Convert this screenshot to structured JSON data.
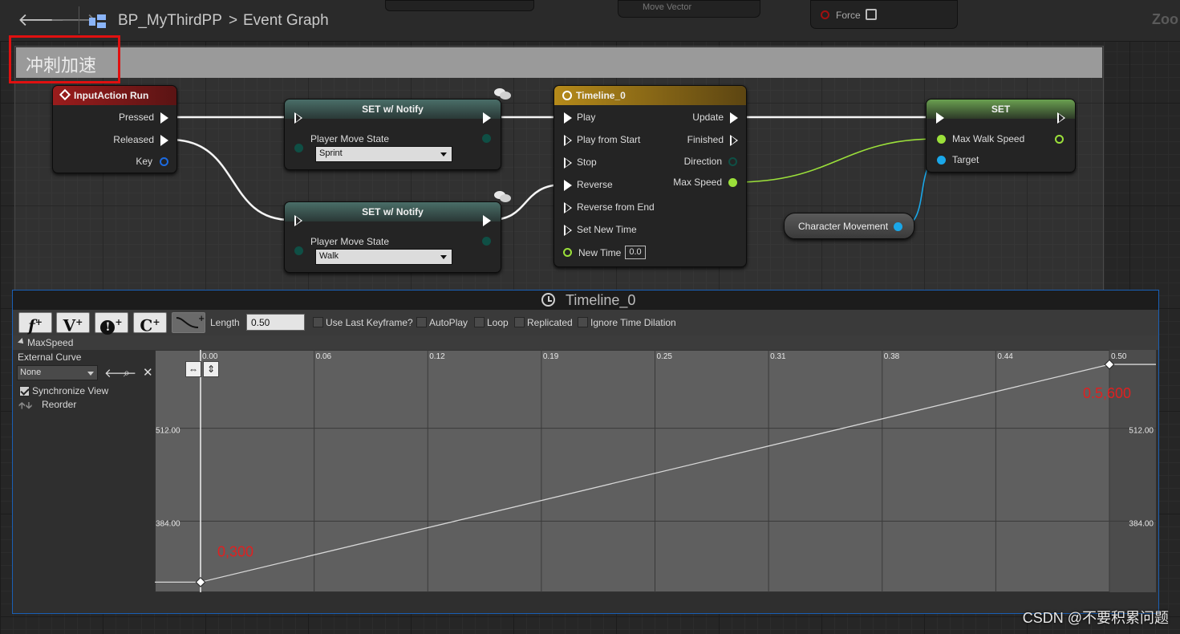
{
  "breadcrumb": {
    "blueprint": "BP_MyThirdPP",
    "separator": ">",
    "graph": "Event Graph"
  },
  "top_partial": {
    "zoom": "Zoo",
    "force": "Force",
    "move_vector": "Move Vector"
  },
  "comment": {
    "title": "冲刺加速"
  },
  "nodes": {
    "input_action": {
      "title": "InputAction Run",
      "pressed": "Pressed",
      "released": "Released",
      "key": "Key"
    },
    "set_sprint": {
      "title": "SET w/ Notify",
      "prop": "Player Move State",
      "value": "Sprint"
    },
    "set_walk": {
      "title": "SET w/ Notify",
      "prop": "Player Move State",
      "value": "Walk"
    },
    "timeline": {
      "title": "Timeline_0",
      "play": "Play",
      "play_from_start": "Play from Start",
      "stop": "Stop",
      "reverse": "Reverse",
      "reverse_from_end": "Reverse from End",
      "set_new_time": "Set New Time",
      "new_time": "New Time",
      "new_time_value": "0.0",
      "update": "Update",
      "finished": "Finished",
      "direction": "Direction",
      "max_speed": "Max Speed"
    },
    "set_speed": {
      "title": "SET",
      "max_walk_speed": "Max Walk Speed",
      "target": "Target"
    },
    "char_movement": {
      "label": "Character Movement"
    }
  },
  "timeline_panel": {
    "title": "Timeline_0",
    "tools": [
      "f",
      "V",
      "!",
      "C"
    ],
    "length_label": "Length",
    "length_value": "0.50",
    "use_last_keyframe": "Use Last Keyframe?",
    "autoplay": "AutoPlay",
    "loop": "Loop",
    "replicated": "Replicated",
    "ignore_time_dilation": "Ignore Time Dilation",
    "track_name": "MaxSpeed",
    "external_curve": "External Curve",
    "external_curve_value": "None",
    "synchronize_view": "Synchronize View",
    "reorder": "Reorder"
  },
  "chart_data": {
    "type": "line",
    "x": [
      0.0,
      0.5
    ],
    "y": [
      300,
      600
    ],
    "x_ticks": [
      "0.00",
      "0.06",
      "0.12",
      "0.19",
      "0.25",
      "0.31",
      "0.38",
      "0.44",
      "0.50"
    ],
    "y_ticks": [
      "512.00",
      "384.00"
    ],
    "annotations": [
      "0,300",
      "0.5,600"
    ],
    "xlim": [
      0.0,
      0.5
    ],
    "ylim": [
      286,
      620
    ]
  },
  "watermark": "CSDN @不要积累问题"
}
